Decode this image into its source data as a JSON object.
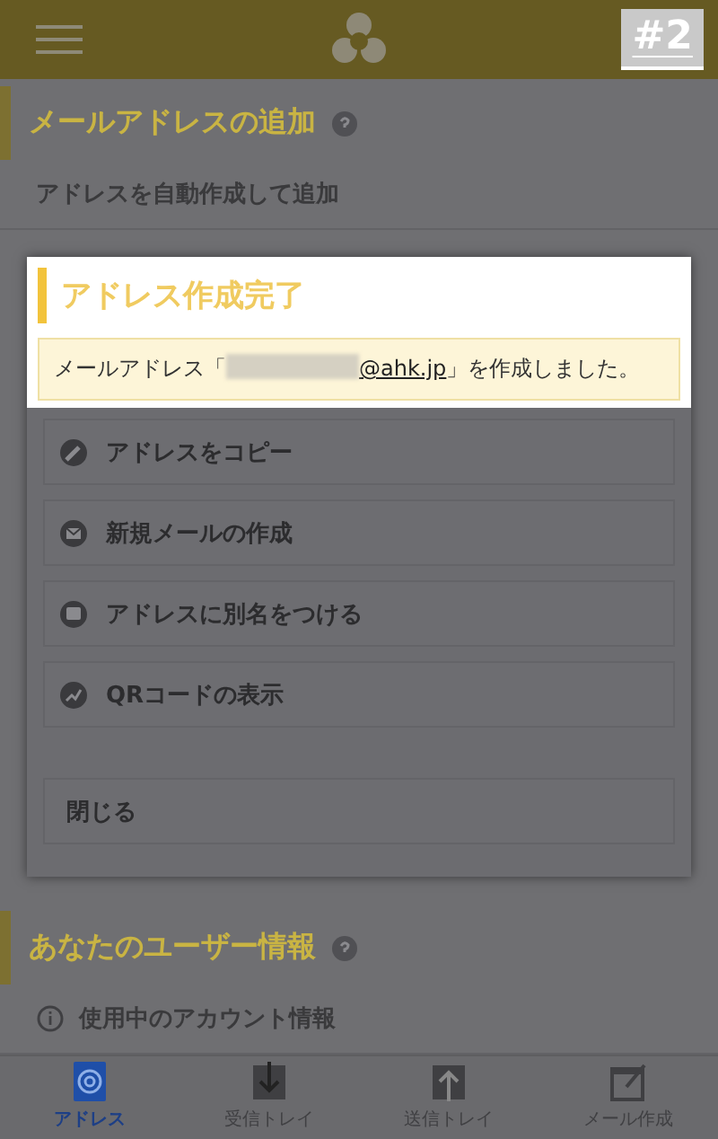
{
  "header": {
    "badge": "#2"
  },
  "sections": [
    {
      "title": "メールアドレスの追加",
      "items": [
        {
          "label": "アドレスを自動作成して追加",
          "kind": "plain"
        }
      ]
    },
    {
      "title": "あなたのユーザー情報",
      "items": [
        {
          "label": "使用中のアカウント情報",
          "kind": "info"
        }
      ]
    }
  ],
  "dialog": {
    "title": "アドレス作成完了",
    "message": {
      "before": "メールアドレス「",
      "address": "@ahk.jp",
      "after": "」を作成しました。",
      "redacted": true
    },
    "actions": [
      {
        "label": "アドレスをコピー",
        "kind": "copy"
      },
      {
        "label": "新規メールの作成",
        "kind": "mail"
      },
      {
        "label": "アドレスに別名をつける",
        "kind": "alias"
      },
      {
        "label": "QRコードの表示",
        "kind": "qr"
      }
    ],
    "close": "閉じる"
  },
  "tabs": [
    {
      "label": "アドレス",
      "kind": "address",
      "selected": true
    },
    {
      "label": "受信トレイ",
      "kind": "inbox",
      "selected": false
    },
    {
      "label": "送信トレイ",
      "kind": "outbox",
      "selected": false
    },
    {
      "label": "メール作成",
      "kind": "compose",
      "selected": false
    }
  ]
}
